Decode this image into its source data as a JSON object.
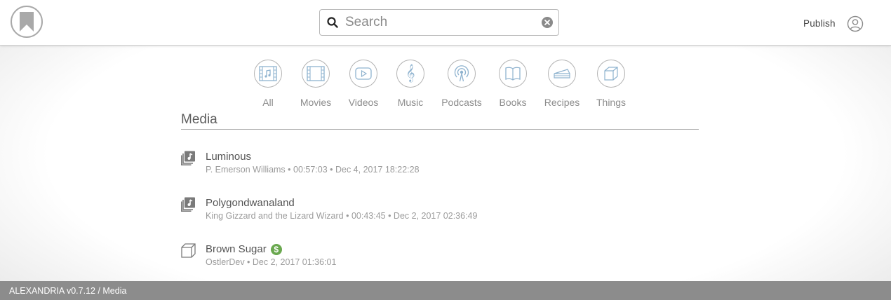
{
  "header": {
    "logo_icon": "bookmark-icon",
    "search": {
      "placeholder": "Search",
      "value": ""
    },
    "publish_label": "Publish",
    "user_icon": "user-icon"
  },
  "categories": [
    {
      "label": "All",
      "icon": "media-library-icon"
    },
    {
      "label": "Movies",
      "icon": "film-icon"
    },
    {
      "label": "Videos",
      "icon": "play-icon"
    },
    {
      "label": "Music",
      "icon": "treble-clef-icon"
    },
    {
      "label": "Podcasts",
      "icon": "broadcast-icon"
    },
    {
      "label": "Books",
      "icon": "book-icon"
    },
    {
      "label": "Recipes",
      "icon": "cake-icon"
    },
    {
      "label": "Things",
      "icon": "cube-icon"
    }
  ],
  "section": {
    "title": "Media"
  },
  "items": [
    {
      "title": "Luminous",
      "meta": "P. Emerson Williams • 00:57:03 • Dec 4, 2017 18:22:28",
      "icon": "music-library-icon",
      "badge": ""
    },
    {
      "title": "Polygondwanaland",
      "meta": "King Gizzard and the Lizard Wizard • 00:43:45 • Dec 2, 2017 02:36:49",
      "icon": "music-library-icon",
      "badge": ""
    },
    {
      "title": "Brown Sugar",
      "meta": "OstlerDev • Dec 2, 2017 01:36:01",
      "icon": "cube-icon",
      "badge": "$"
    }
  ],
  "footer": {
    "text": "ALEXANDRIA v0.7.12 / Media"
  },
  "colors": {
    "icon_blue": "#8fb3cf",
    "badge_green": "#6aa84f",
    "footer_bg": "#8c8c8c"
  }
}
